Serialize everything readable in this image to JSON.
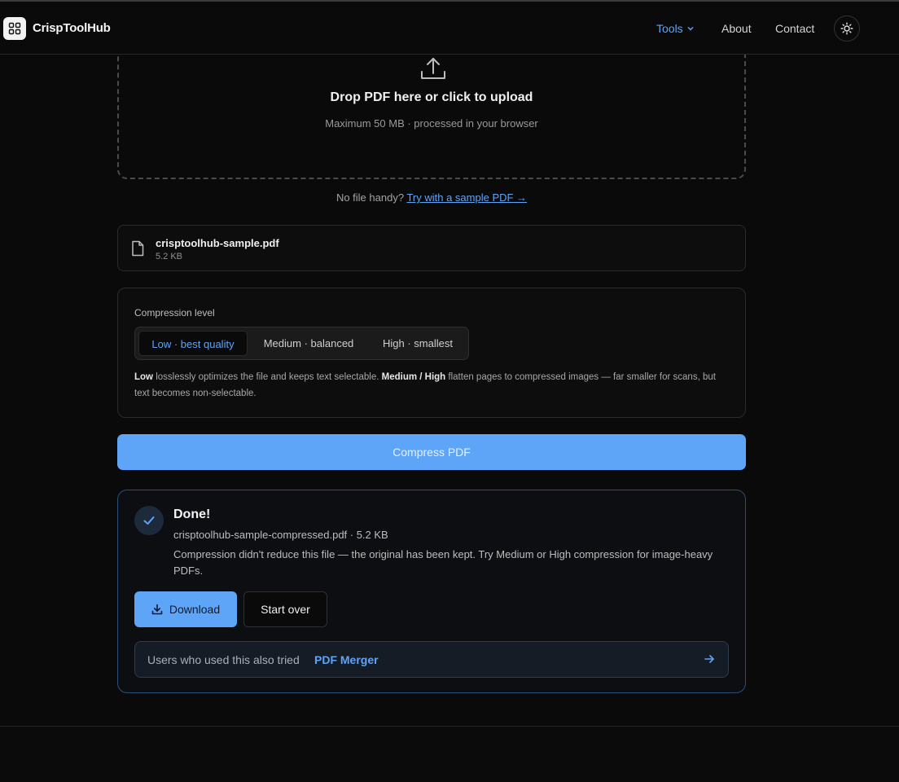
{
  "header": {
    "brand": "CrispToolHub",
    "nav": {
      "tools": "Tools",
      "about": "About",
      "contact": "Contact"
    },
    "icons": {
      "logo": "grid-icon",
      "tools_dropdown": "chevron-down-icon",
      "theme": "sun-icon"
    }
  },
  "dropzone": {
    "title": "Drop PDF here or click to upload",
    "subtitle": "Maximum 50 MB · processed in your browser",
    "icon": "upload-icon"
  },
  "sample": {
    "prefix": "No file handy?",
    "link": "Try with a sample PDF →"
  },
  "file": {
    "name": "crisptoolhub-sample.pdf",
    "size": "5.2 KB",
    "icon": "file-icon"
  },
  "compression": {
    "label": "Compression level",
    "options": [
      {
        "label": "Low · best quality",
        "active": true
      },
      {
        "label": "Medium · balanced",
        "active": false
      },
      {
        "label": "High · smallest",
        "active": false
      }
    ],
    "desc": {
      "low": "Low",
      "part1": " losslessly optimizes the file and keeps text selectable. ",
      "medhigh": "Medium / High",
      "part2": " flatten pages to compressed images — far smaller for scans, but text becomes non-selectable."
    }
  },
  "compress_button": "Compress PDF",
  "result": {
    "title": "Done!",
    "file_line": "crisptoolhub-sample-compressed.pdf · 5.2 KB",
    "message": "Compression didn't reduce this file — the original has been kept. Try Medium or High compression for image-heavy PDFs.",
    "download": "Download",
    "start_over": "Start over",
    "suggest_prefix": "Users who used this also tried",
    "suggest_link": "PDF Merger",
    "icons": {
      "status": "check-icon",
      "download": "download-icon",
      "suggest": "arrow-right-icon"
    }
  },
  "colors": {
    "accent": "#5ea4f7",
    "background": "#0a0a0a",
    "result_border": "#2c4f78"
  }
}
